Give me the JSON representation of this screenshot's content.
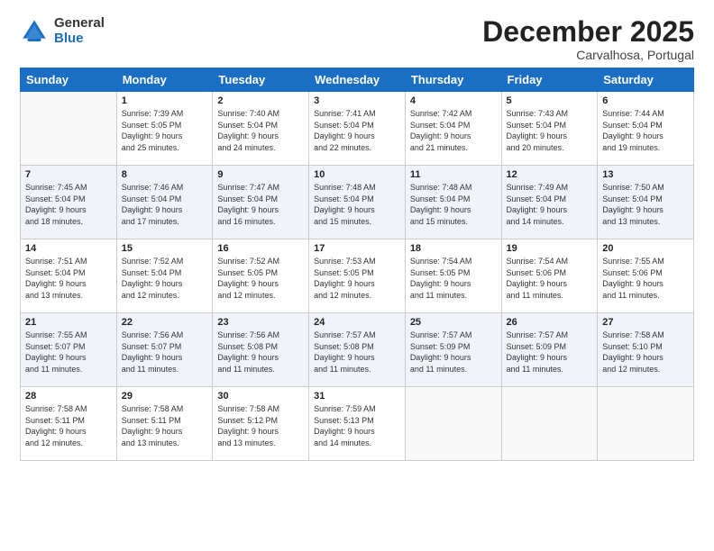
{
  "logo": {
    "general": "General",
    "blue": "Blue"
  },
  "header": {
    "month": "December 2025",
    "location": "Carvalhosa, Portugal"
  },
  "weekdays": [
    "Sunday",
    "Monday",
    "Tuesday",
    "Wednesday",
    "Thursday",
    "Friday",
    "Saturday"
  ],
  "weeks": [
    [
      {
        "day": "",
        "info": ""
      },
      {
        "day": "1",
        "info": "Sunrise: 7:39 AM\nSunset: 5:05 PM\nDaylight: 9 hours\nand 25 minutes."
      },
      {
        "day": "2",
        "info": "Sunrise: 7:40 AM\nSunset: 5:04 PM\nDaylight: 9 hours\nand 24 minutes."
      },
      {
        "day": "3",
        "info": "Sunrise: 7:41 AM\nSunset: 5:04 PM\nDaylight: 9 hours\nand 22 minutes."
      },
      {
        "day": "4",
        "info": "Sunrise: 7:42 AM\nSunset: 5:04 PM\nDaylight: 9 hours\nand 21 minutes."
      },
      {
        "day": "5",
        "info": "Sunrise: 7:43 AM\nSunset: 5:04 PM\nDaylight: 9 hours\nand 20 minutes."
      },
      {
        "day": "6",
        "info": "Sunrise: 7:44 AM\nSunset: 5:04 PM\nDaylight: 9 hours\nand 19 minutes."
      }
    ],
    [
      {
        "day": "7",
        "info": "Sunrise: 7:45 AM\nSunset: 5:04 PM\nDaylight: 9 hours\nand 18 minutes."
      },
      {
        "day": "8",
        "info": "Sunrise: 7:46 AM\nSunset: 5:04 PM\nDaylight: 9 hours\nand 17 minutes."
      },
      {
        "day": "9",
        "info": "Sunrise: 7:47 AM\nSunset: 5:04 PM\nDaylight: 9 hours\nand 16 minutes."
      },
      {
        "day": "10",
        "info": "Sunrise: 7:48 AM\nSunset: 5:04 PM\nDaylight: 9 hours\nand 15 minutes."
      },
      {
        "day": "11",
        "info": "Sunrise: 7:48 AM\nSunset: 5:04 PM\nDaylight: 9 hours\nand 15 minutes."
      },
      {
        "day": "12",
        "info": "Sunrise: 7:49 AM\nSunset: 5:04 PM\nDaylight: 9 hours\nand 14 minutes."
      },
      {
        "day": "13",
        "info": "Sunrise: 7:50 AM\nSunset: 5:04 PM\nDaylight: 9 hours\nand 13 minutes."
      }
    ],
    [
      {
        "day": "14",
        "info": "Sunrise: 7:51 AM\nSunset: 5:04 PM\nDaylight: 9 hours\nand 13 minutes."
      },
      {
        "day": "15",
        "info": "Sunrise: 7:52 AM\nSunset: 5:04 PM\nDaylight: 9 hours\nand 12 minutes."
      },
      {
        "day": "16",
        "info": "Sunrise: 7:52 AM\nSunset: 5:05 PM\nDaylight: 9 hours\nand 12 minutes."
      },
      {
        "day": "17",
        "info": "Sunrise: 7:53 AM\nSunset: 5:05 PM\nDaylight: 9 hours\nand 12 minutes."
      },
      {
        "day": "18",
        "info": "Sunrise: 7:54 AM\nSunset: 5:05 PM\nDaylight: 9 hours\nand 11 minutes."
      },
      {
        "day": "19",
        "info": "Sunrise: 7:54 AM\nSunset: 5:06 PM\nDaylight: 9 hours\nand 11 minutes."
      },
      {
        "day": "20",
        "info": "Sunrise: 7:55 AM\nSunset: 5:06 PM\nDaylight: 9 hours\nand 11 minutes."
      }
    ],
    [
      {
        "day": "21",
        "info": "Sunrise: 7:55 AM\nSunset: 5:07 PM\nDaylight: 9 hours\nand 11 minutes."
      },
      {
        "day": "22",
        "info": "Sunrise: 7:56 AM\nSunset: 5:07 PM\nDaylight: 9 hours\nand 11 minutes."
      },
      {
        "day": "23",
        "info": "Sunrise: 7:56 AM\nSunset: 5:08 PM\nDaylight: 9 hours\nand 11 minutes."
      },
      {
        "day": "24",
        "info": "Sunrise: 7:57 AM\nSunset: 5:08 PM\nDaylight: 9 hours\nand 11 minutes."
      },
      {
        "day": "25",
        "info": "Sunrise: 7:57 AM\nSunset: 5:09 PM\nDaylight: 9 hours\nand 11 minutes."
      },
      {
        "day": "26",
        "info": "Sunrise: 7:57 AM\nSunset: 5:09 PM\nDaylight: 9 hours\nand 11 minutes."
      },
      {
        "day": "27",
        "info": "Sunrise: 7:58 AM\nSunset: 5:10 PM\nDaylight: 9 hours\nand 12 minutes."
      }
    ],
    [
      {
        "day": "28",
        "info": "Sunrise: 7:58 AM\nSunset: 5:11 PM\nDaylight: 9 hours\nand 12 minutes."
      },
      {
        "day": "29",
        "info": "Sunrise: 7:58 AM\nSunset: 5:11 PM\nDaylight: 9 hours\nand 13 minutes."
      },
      {
        "day": "30",
        "info": "Sunrise: 7:58 AM\nSunset: 5:12 PM\nDaylight: 9 hours\nand 13 minutes."
      },
      {
        "day": "31",
        "info": "Sunrise: 7:59 AM\nSunset: 5:13 PM\nDaylight: 9 hours\nand 14 minutes."
      },
      {
        "day": "",
        "info": ""
      },
      {
        "day": "",
        "info": ""
      },
      {
        "day": "",
        "info": ""
      }
    ]
  ]
}
